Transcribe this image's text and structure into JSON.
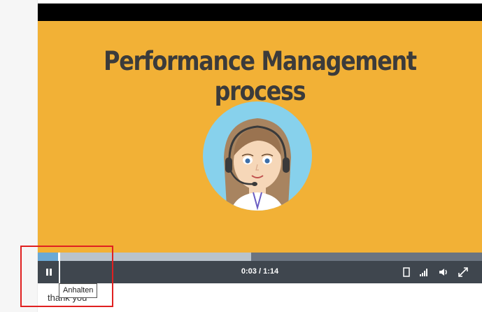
{
  "video": {
    "title": "Performance Management process",
    "background_color": "#f2b136",
    "avatar_icon": "support-agent-avatar"
  },
  "player": {
    "progress_played_fraction": 0.045,
    "progress_buffered_fraction": 0.48,
    "time_display": "0:03 / 1:14",
    "pause_icon": "pause-icon",
    "controls_right": [
      "fullscreen-toggle-icon",
      "quality-signal-icon",
      "volume-icon",
      "expand-icon"
    ]
  },
  "tooltip": {
    "text": "Anhalten"
  },
  "caption": {
    "text": "thank you"
  },
  "annotation": {
    "highlight_color": "#e02020"
  }
}
